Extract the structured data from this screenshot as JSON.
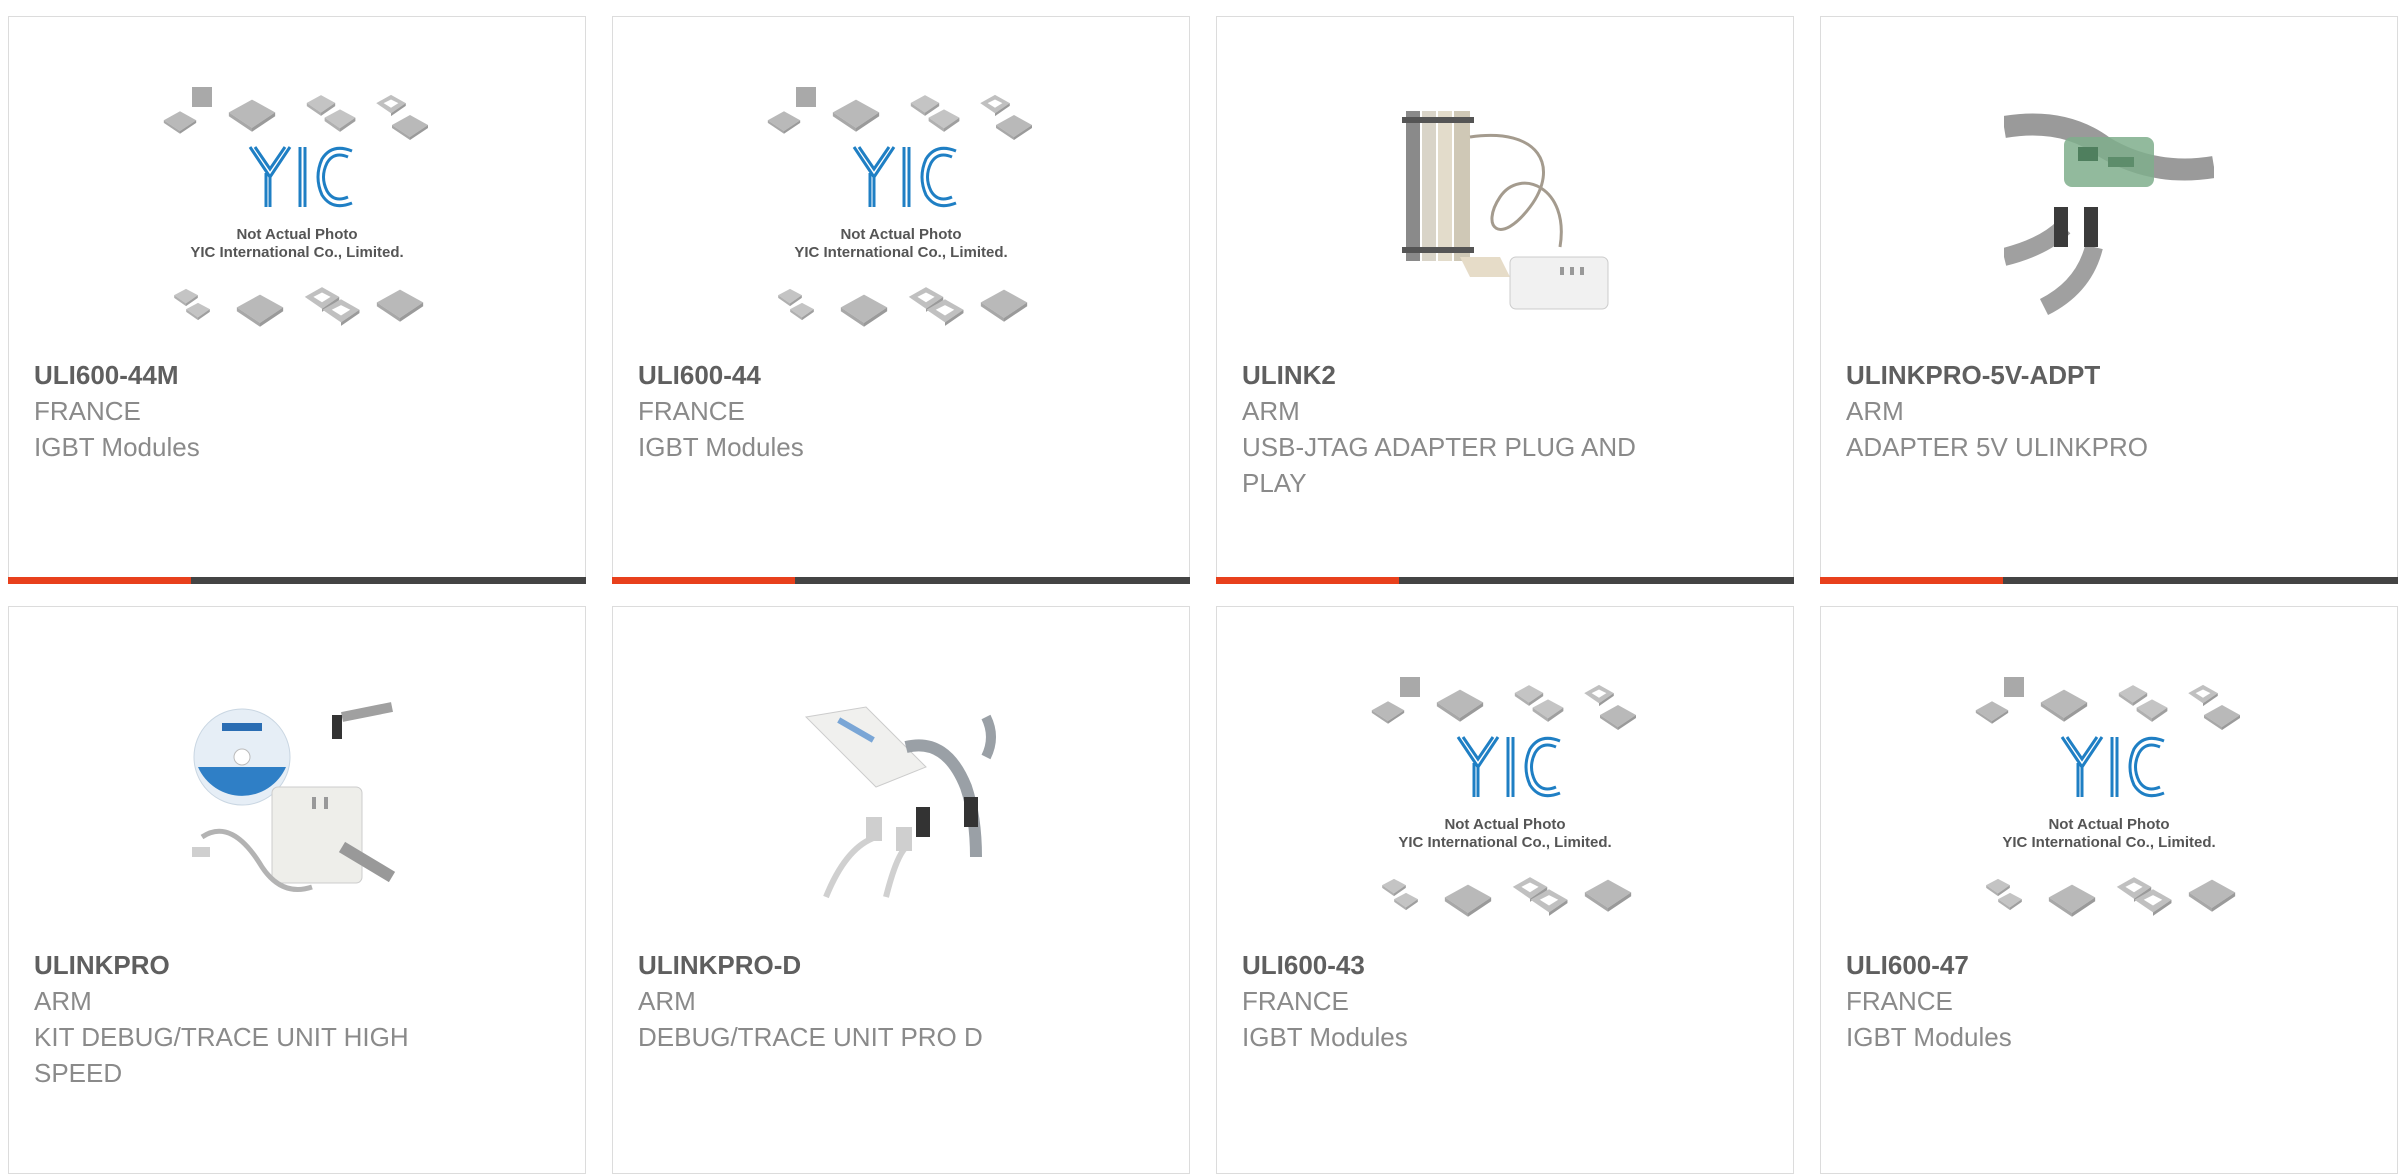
{
  "colors": {
    "accent": "#e8401c",
    "bar": "#444444",
    "part_number": "#5f5f5f",
    "text": "#8a8a8a",
    "border": "#dcdcdc",
    "yic_blue": "#1f7fc4"
  },
  "placeholder": {
    "line1": "Not Actual Photo",
    "line2": "YIC International Co., Limited."
  },
  "products": [
    {
      "part_number": "ULI600-44M",
      "manufacturer": "FRANCE",
      "description": "IGBT Modules",
      "image": "yic-placeholder-image"
    },
    {
      "part_number": "ULI600-44",
      "manufacturer": "FRANCE",
      "description": "IGBT Modules",
      "image": "yic-placeholder-image"
    },
    {
      "part_number": "ULINK2",
      "manufacturer": "ARM",
      "description": "USB-JTAG ADAPTER PLUG AND PLAY",
      "image": "ulink2-photo"
    },
    {
      "part_number": "ULINKPRO-5V-ADPT",
      "manufacturer": "ARM",
      "description": "ADAPTER 5V ULINKPRO",
      "image": "ulinkpro-5v-adapter-photo"
    },
    {
      "part_number": "ULINKPRO",
      "manufacturer": "ARM",
      "description": "KIT DEBUG/TRACE UNIT HIGH SPEED",
      "image": "ulinkpro-kit-photo"
    },
    {
      "part_number": "ULINKPRO-D",
      "manufacturer": "ARM",
      "description": "DEBUG/TRACE UNIT PRO D",
      "image": "ulinkpro-d-photo"
    },
    {
      "part_number": "ULI600-43",
      "manufacturer": "FRANCE",
      "description": "IGBT Modules",
      "image": "yic-placeholder-image"
    },
    {
      "part_number": "ULI600-47",
      "manufacturer": "FRANCE",
      "description": "IGBT Modules",
      "image": "yic-placeholder-image"
    }
  ]
}
